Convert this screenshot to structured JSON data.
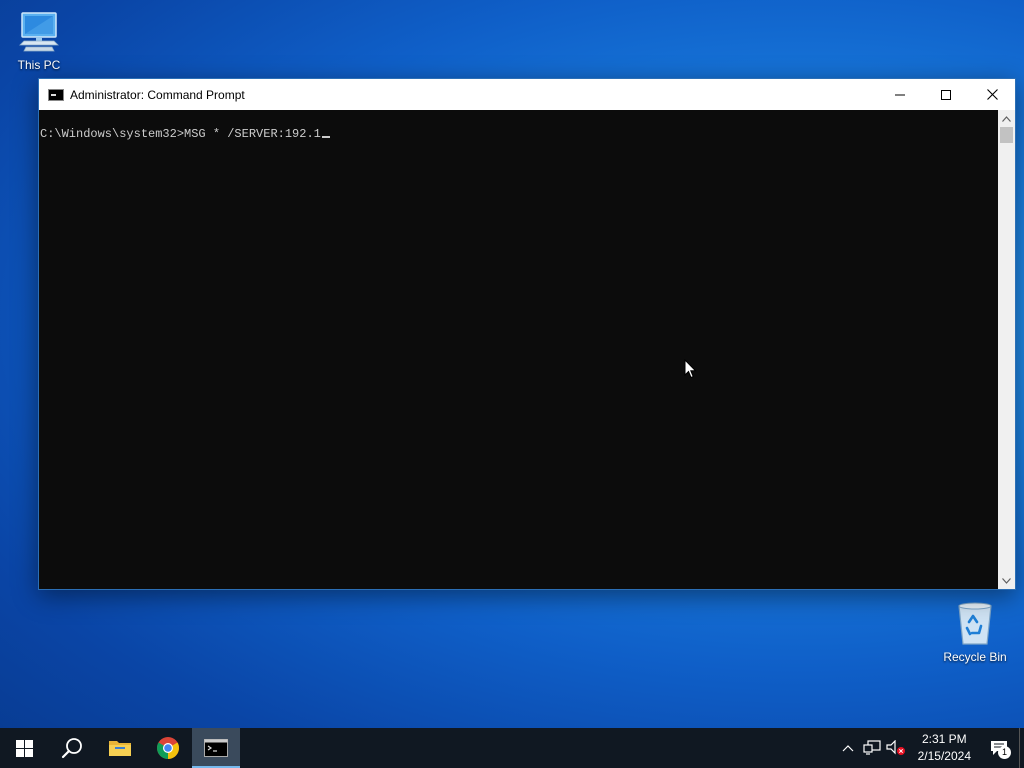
{
  "desktop": {
    "icons": [
      {
        "label": "This PC",
        "icon": "computer-icon"
      },
      {
        "label": "Recycle Bin",
        "icon": "recycle-bin-icon"
      }
    ]
  },
  "window": {
    "title": "Administrator: Command Prompt",
    "console_text": "C:\\Windows\\system32>MSG * /SERVER:192.1"
  },
  "taskbar": {
    "apps": [
      {
        "name": "start",
        "icon": "windows-logo-icon"
      },
      {
        "name": "search",
        "icon": "search-icon"
      },
      {
        "name": "file-explorer",
        "icon": "folder-icon"
      },
      {
        "name": "chrome",
        "icon": "chrome-icon"
      },
      {
        "name": "command-prompt",
        "icon": "terminal-icon",
        "active": true
      }
    ],
    "clock": {
      "time": "2:31 PM",
      "date": "2/15/2024"
    },
    "notification_count": "1"
  }
}
